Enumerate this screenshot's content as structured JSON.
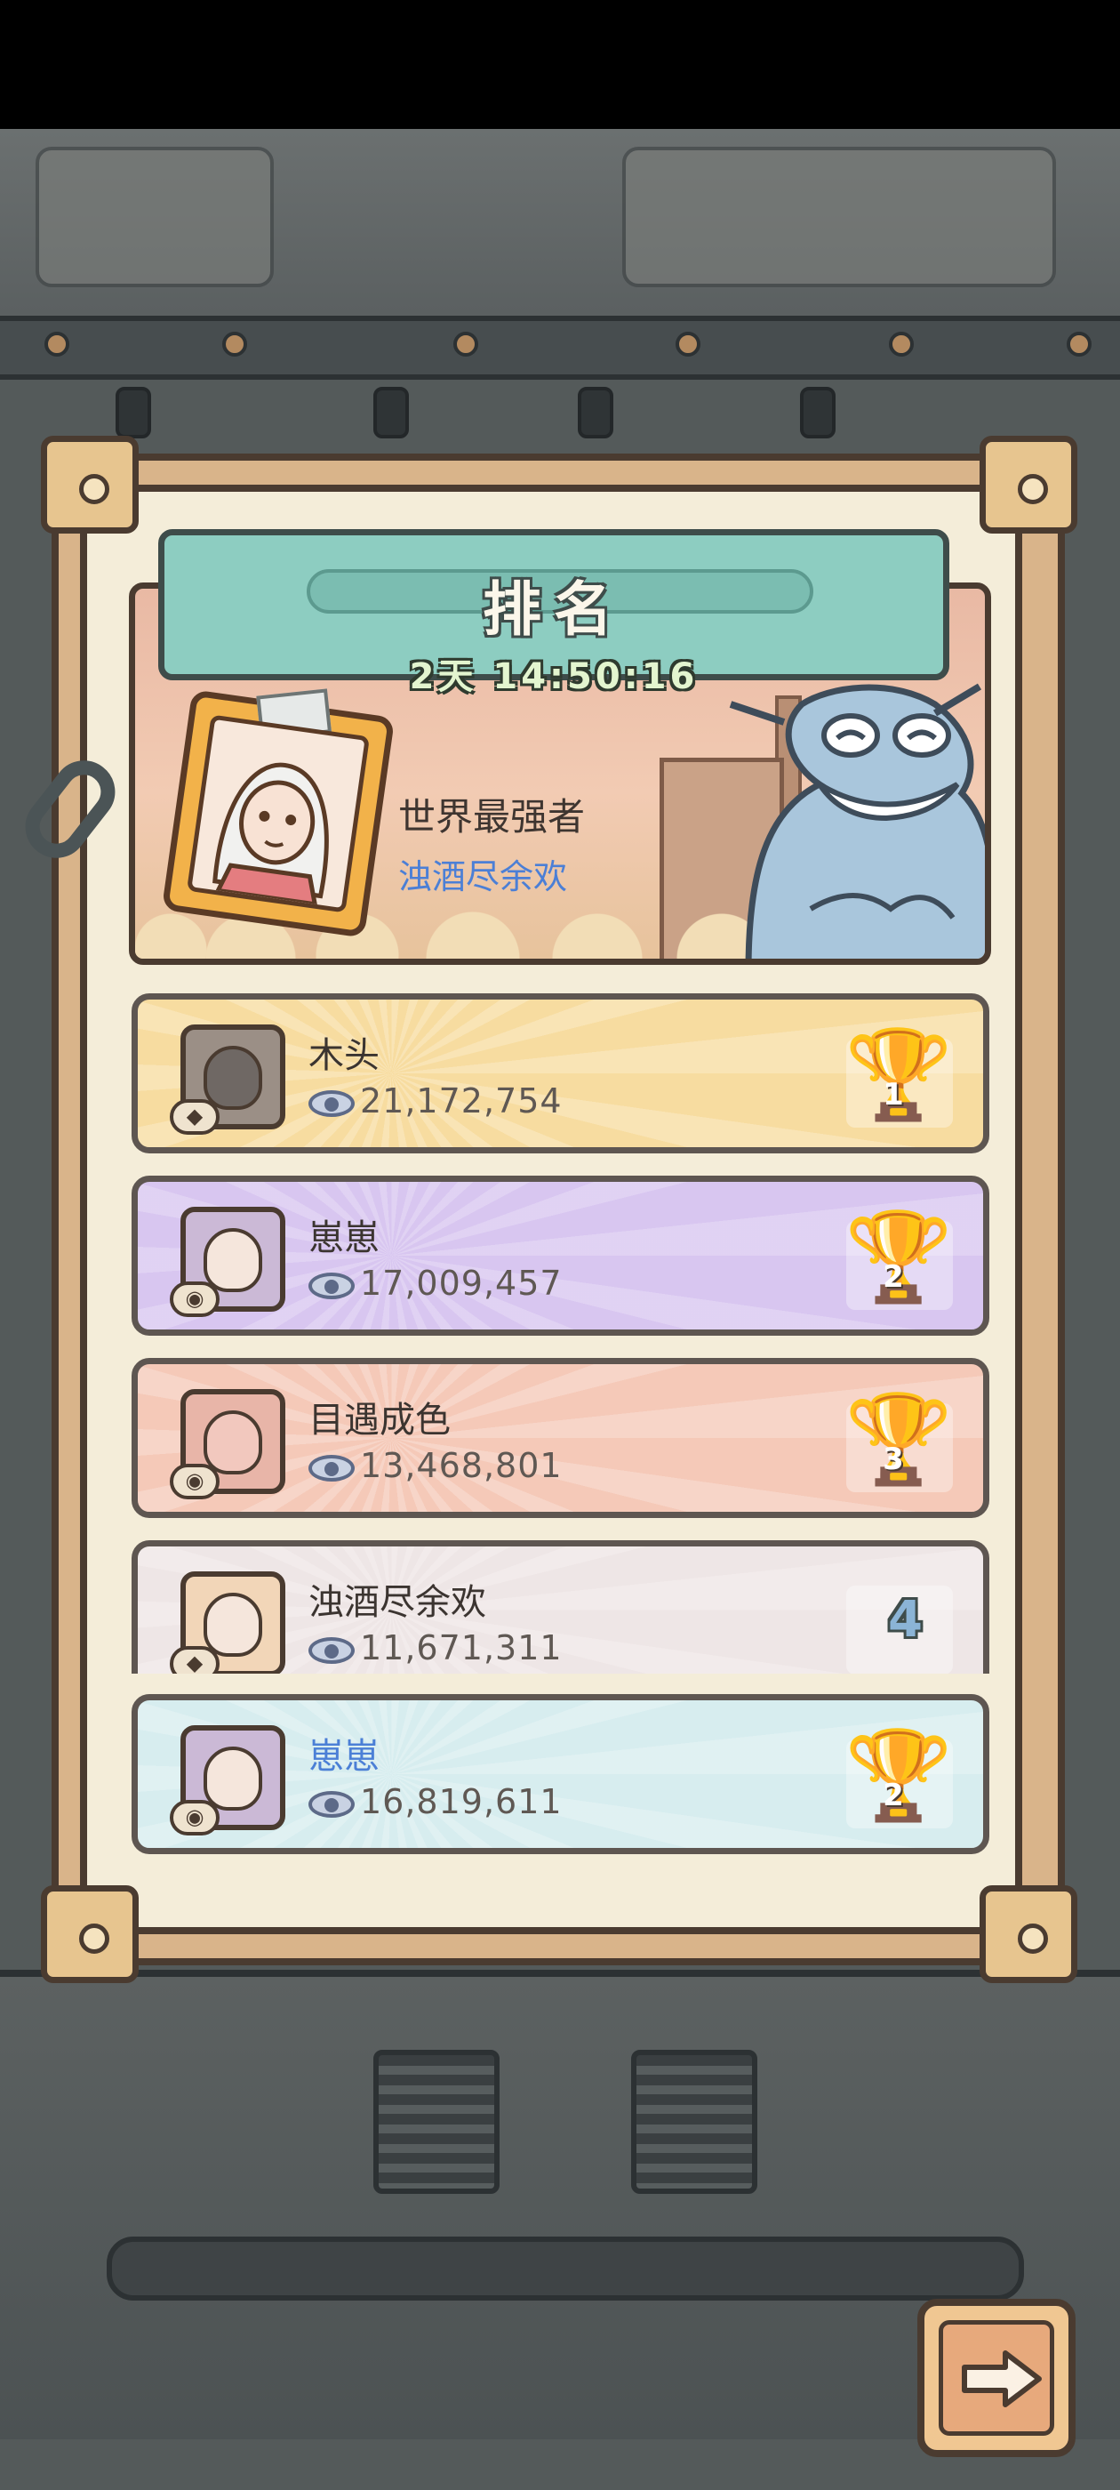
{
  "panel": {
    "title": "排名",
    "timer": "2天 14:50:16"
  },
  "champion": {
    "title": "世界最强者",
    "name": "浊酒尽余欢"
  },
  "rankings": [
    {
      "rank": "1",
      "name": "木头",
      "score": "21,172,754",
      "color": "#f7dca0"
    },
    {
      "rank": "2",
      "name": "崽崽",
      "score": "17,009,457",
      "color": "#d8c6f0"
    },
    {
      "rank": "3",
      "name": "目遇成色",
      "score": "13,468,801",
      "color": "#f5c9b8"
    },
    {
      "rank": "4",
      "name": "浊酒尽余欢",
      "score": "11,671,311",
      "color": "#eee6e6"
    }
  ],
  "self": {
    "rank": "2",
    "name": "崽崽",
    "score": "16,819,611",
    "color": "#d7edef"
  },
  "icons": {
    "eye": "eye-icon",
    "trophy_gold": "gold-trophy-icon",
    "trophy_silver": "silver-trophy-icon",
    "trophy_bronze": "bronze-trophy-icon",
    "next": "arrow-right-icon"
  }
}
